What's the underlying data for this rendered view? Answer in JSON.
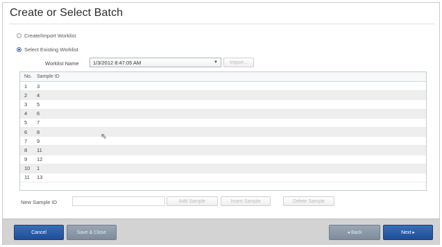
{
  "title": "Create or Select Batch",
  "options": {
    "create_label": "Create/Import Worklist",
    "select_label": "Select Existing Worklist",
    "selected": "select"
  },
  "worklist": {
    "label": "Worklist Name",
    "value": "1/3/2012 8:47:05 AM",
    "import_label": "Import..."
  },
  "grid": {
    "headers": {
      "no": "No.",
      "sample_id": "Sample ID"
    },
    "rows": [
      {
        "no": "1",
        "sample_id": "3"
      },
      {
        "no": "2",
        "sample_id": "4"
      },
      {
        "no": "3",
        "sample_id": "5"
      },
      {
        "no": "4",
        "sample_id": "6"
      },
      {
        "no": "5",
        "sample_id": "7"
      },
      {
        "no": "6",
        "sample_id": "8"
      },
      {
        "no": "7",
        "sample_id": "9"
      },
      {
        "no": "8",
        "sample_id": "11"
      },
      {
        "no": "9",
        "sample_id": "12"
      },
      {
        "no": "10",
        "sample_id": "1"
      },
      {
        "no": "11",
        "sample_id": "13"
      }
    ]
  },
  "new_sample": {
    "label": "New Sample ID",
    "value": "",
    "add_label": "Add Sample",
    "insert_label": "Insert Sample",
    "delete_label": "Delete Sample"
  },
  "footer": {
    "cancel_label": "Cancel",
    "save_close_label": "Save & Close",
    "back_label": "◂ Back",
    "next_label": "Next ▸"
  },
  "colors": {
    "accent_blue": "#2a5ca8",
    "disabled_gray": "#8a95a3",
    "row_stripe": "#eeeeee"
  }
}
